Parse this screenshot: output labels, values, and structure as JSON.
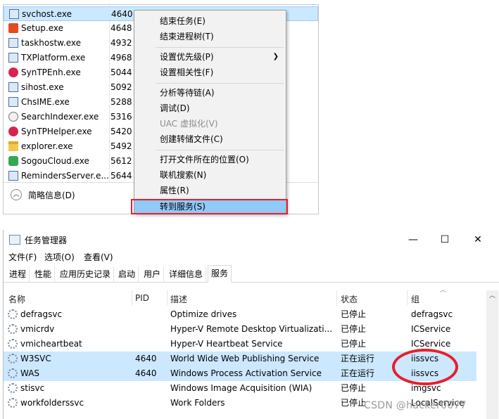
{
  "processes": [
    {
      "name": "svchost.exe",
      "pid": "4640",
      "icon": "window-icon"
    },
    {
      "name": "Setup.exe",
      "pid": "4648",
      "icon": "office-icon"
    },
    {
      "name": "taskhostw.exe",
      "pid": "4932",
      "icon": "window-icon"
    },
    {
      "name": "TXPlatform.exe",
      "pid": "4968",
      "icon": "window-icon"
    },
    {
      "name": "SynTPEnh.exe",
      "pid": "5044",
      "icon": "synaptics-icon"
    },
    {
      "name": "sihost.exe",
      "pid": "5092",
      "icon": "window-icon"
    },
    {
      "name": "ChsIME.exe",
      "pid": "5288",
      "icon": "window-icon"
    },
    {
      "name": "SearchIndexer.exe",
      "pid": "5316",
      "icon": "search-indexer-icon"
    },
    {
      "name": "SynTPHelper.exe",
      "pid": "5420",
      "icon": "synaptics-icon"
    },
    {
      "name": "explorer.exe",
      "pid": "5492",
      "icon": "folder-icon"
    },
    {
      "name": "SogouCloud.exe",
      "pid": "5612",
      "icon": "sogou-icon"
    },
    {
      "name": "RemindersServer.e...",
      "pid": "5644",
      "icon": "window-icon"
    }
  ],
  "fewer_details": "简略信息(D)",
  "context_menu": {
    "end_task": "结束任务(E)",
    "end_tree": "结束进程树(T)",
    "set_priority": "设置优先级(P)",
    "set_affinity": "设置相关性(F)",
    "analyze_wait": "分析等待链(A)",
    "debug": "调试(D)",
    "uac_virtualization": "UAC 虚拟化(V)",
    "create_dump": "创建转储文件(C)",
    "open_location": "打开文件所在的位置(O)",
    "search_online": "联机搜索(N)",
    "properties": "属性(R)",
    "go_to_services": "转到服务(S)"
  },
  "window": {
    "title": "任务管理器",
    "minimize": "—",
    "maximize": "☐",
    "close": "✕"
  },
  "menu": {
    "file": "文件(F)",
    "options": "选项(O)",
    "view": "查看(V)"
  },
  "tabs": [
    "进程",
    "性能",
    "应用历史记录",
    "启动",
    "用户",
    "详细信息",
    "服务"
  ],
  "active_tab": "服务",
  "columns": {
    "name": "名称",
    "pid": "PID",
    "desc": "描述",
    "status": "状态",
    "group": "组"
  },
  "services": [
    {
      "name": "defragsvc",
      "pid": "",
      "desc": "Optimize drives",
      "status": "已停止",
      "group": "defragsvc",
      "selected": false
    },
    {
      "name": "vmicrdv",
      "pid": "",
      "desc": "Hyper-V Remote Desktop Virtualizati...",
      "status": "已停止",
      "group": "ICService",
      "selected": false
    },
    {
      "name": "vmicheartbeat",
      "pid": "",
      "desc": "Hyper-V Heartbeat Service",
      "status": "已停止",
      "group": "ICService",
      "selected": false
    },
    {
      "name": "W3SVC",
      "pid": "4640",
      "desc": "World Wide Web Publishing Service",
      "status": "正在运行",
      "group": "iissvcs",
      "selected": true
    },
    {
      "name": "WAS",
      "pid": "4640",
      "desc": "Windows Process Activation Service",
      "status": "正在运行",
      "group": "iissvcs",
      "selected": true
    },
    {
      "name": "stisvc",
      "pid": "",
      "desc": "Windows Image Acquisition (WIA)",
      "status": "已停止",
      "group": "imgsvc",
      "selected": false
    },
    {
      "name": "workfolderssvc",
      "pid": "",
      "desc": "Work Folders",
      "status": "已停止",
      "group": "LocalService",
      "selected": false
    }
  ],
  "watermark": "CSDN @hacker0077",
  "colors": {
    "selection": "#cce8ff",
    "menu_highlight": "#91c9f7",
    "annotation_red": "#e5202e"
  }
}
